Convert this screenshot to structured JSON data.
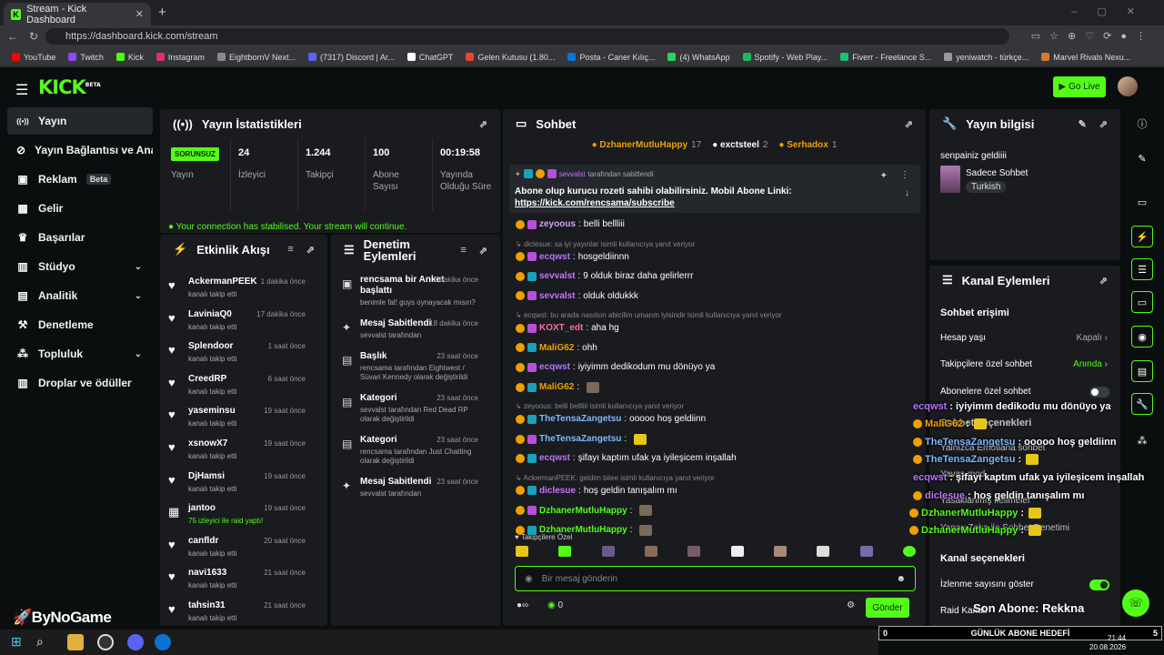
{
  "browser": {
    "tab_title": "Stream - Kick Dashboard",
    "url": "https://dashboard.kick.com/stream",
    "bookmarks": [
      {
        "label": "YouTube",
        "color": "#ff0000"
      },
      {
        "label": "Twitch",
        "color": "#9146ff"
      },
      {
        "label": "Kick",
        "color": "#53fc18"
      },
      {
        "label": "Instagram",
        "color": "#e1306c"
      },
      {
        "label": "EightbornV Next...",
        "color": "#888888"
      },
      {
        "label": "(7317) Discord | Ar...",
        "color": "#5865f2"
      },
      {
        "label": "ChatGPT",
        "color": "#ffffff"
      },
      {
        "label": "Gelen Kutusu (1.80...",
        "color": "#ea4335"
      },
      {
        "label": "Posta - Caner Kılıç...",
        "color": "#0078d4"
      },
      {
        "label": "(4) WhatsApp",
        "color": "#25d366"
      },
      {
        "label": "Spotify - Web Play...",
        "color": "#1db954"
      },
      {
        "label": "Fiverr - Freelance S...",
        "color": "#1dbf73"
      },
      {
        "label": "yeniwatch - türkçe...",
        "color": "#999999"
      },
      {
        "label": "Marvel Rivals Nexu...",
        "color": "#d97b29"
      }
    ]
  },
  "header": {
    "logo": "KICK",
    "logo_tag": "BETA",
    "golive": "Go Live"
  },
  "sidebar": [
    {
      "label": "Yayın",
      "icon": "broadcast-icon"
    },
    {
      "label": "Yayın Bağlantısı ve Anahtar",
      "icon": "link-icon"
    },
    {
      "label": "Reklam",
      "badge": "Beta",
      "icon": "ad-icon"
    },
    {
      "label": "Gelir",
      "icon": "revenue-icon"
    },
    {
      "label": "Başarılar",
      "icon": "trophy-icon"
    },
    {
      "label": "Stüdyo",
      "icon": "studio-icon"
    },
    {
      "label": "Analitik",
      "icon": "analytics-icon"
    },
    {
      "label": "Denetleme",
      "icon": "hammer-icon"
    },
    {
      "label": "Topluluk",
      "icon": "community-icon"
    },
    {
      "label": "Droplar ve ödüller",
      "icon": "gift-icon"
    }
  ],
  "stats": {
    "title": "Yayın İstatistikleri",
    "status": "SORUNSUZ",
    "status_label": "Yayın",
    "viewers": "24",
    "viewers_label": "İzleyici",
    "followers": "1.244",
    "followers_label": "Takipçi",
    "subs": "100",
    "subs_label": "Abone Sayısı",
    "uptime": "00:19:58",
    "uptime_label": "Yayında Olduğu Süre",
    "conn": "Your connection has stabilised. Your stream will continue."
  },
  "feed": {
    "title": "Etkinlik Akışı",
    "items": [
      {
        "name": "AckermanPEEK",
        "sub": "kanalı takip etti",
        "time": "1 dakika önce"
      },
      {
        "name": "LaviniaQ0",
        "sub": "kanalı takip etti",
        "time": "17 dakika önce"
      },
      {
        "name": "Splendoor",
        "sub": "kanalı takip etti",
        "time": "1 saat önce"
      },
      {
        "name": "CreedRP",
        "sub": "kanalı takip etti",
        "time": "6 saat önce"
      },
      {
        "name": "yaseminsu",
        "sub": "kanalı takip etti",
        "time": "19 saat önce"
      },
      {
        "name": "xsnowX7",
        "sub": "kanalı takip etti",
        "time": "19 saat önce"
      },
      {
        "name": "DjHamsi",
        "sub": "kanalı takip etti",
        "time": "19 saat önce"
      },
      {
        "name": "jantoo",
        "sub": "75 izleyici ile raid yaptı!",
        "time": "19 saat önce"
      },
      {
        "name": "canfldr",
        "sub": "kanalı takip etti",
        "time": "20 saat önce"
      },
      {
        "name": "navi1633",
        "sub": "kanalı takip etti",
        "time": "21 saat önce"
      },
      {
        "name": "tahsin31",
        "sub": "kanalı takip etti",
        "time": "21 saat önce"
      }
    ]
  },
  "mod": {
    "title": "Denetim Eylemleri",
    "items": [
      {
        "title": "rencsama bir Anket başlattı",
        "time": "2 dakika önce",
        "sub": "benimle fal! guys oynayacak mısın?"
      },
      {
        "title": "Mesaj Sabitlendi",
        "time": "18 dakika önce",
        "sub": "sevvalst tarafından"
      },
      {
        "title": "Başlık",
        "time": "23 saat önce",
        "sub": "rencsama tarafından Eightwest / Süvari Kennedy olarak değiştirildi"
      },
      {
        "title": "Kategori",
        "time": "23 saat önce",
        "sub": "sevvalst tarafından Red Dead RP olarak değiştirildi"
      },
      {
        "title": "Kategori",
        "time": "23 saat önce",
        "sub": "rencsama tarafından Just Chatting olarak değiştirildi"
      },
      {
        "title": "Mesaj Sabitlendi",
        "time": "23 saat önce",
        "sub": "sevvalst tarafından"
      }
    ]
  },
  "chat": {
    "title": "Sohbet",
    "top": [
      {
        "name": "DzhanerMutluHappy",
        "n": "17",
        "color": "#f0a000"
      },
      {
        "name": "exctsteel",
        "n": "2",
        "color": "#ffffff"
      },
      {
        "name": "Serhadox",
        "n": "1",
        "color": "#f0a000"
      }
    ],
    "pinned_by": "sevvalst",
    "pinned_suffix": "tarafından sabitlendi",
    "pinned_msg": "Abone olup kurucu rozeti sahibi olabilirsiniz. Mobil Abone Linki:",
    "pinned_link": "https://kick.com/rencsama/subscribe",
    "messages": [
      {
        "user": "zeyoous",
        "color": "#d4a0ff",
        "text": "belli bellliii"
      },
      {
        "reply": "diclesue: sa iyi yayınlar isimli kullanıcıya yanıt veriyor"
      },
      {
        "user": "ecqwst",
        "color": "#b873ff",
        "text": "hosgeldiinnn"
      },
      {
        "user": "sevvalst",
        "color": "#c873ff",
        "text": "9 olduk biraz daha gelirlerrr"
      },
      {
        "user": "sevvalst",
        "color": "#c873ff",
        "text": "olduk oldukkk"
      },
      {
        "reply": "ecqwst: bu arada nasılsın abicilim umarım iyisindir isimli kullanıcıya yanıt veriyor"
      },
      {
        "user": "KOXT_edt",
        "color": "#ff6b9a",
        "text": "aha hg"
      },
      {
        "user": "MaliG62",
        "color": "#f0a000",
        "text": "ohh"
      },
      {
        "user": "ecqwst",
        "color": "#b873ff",
        "text": "iyiyimm dedikodum mu dönüyo ya"
      },
      {
        "user": "MaliG62",
        "color": "#f0a000",
        "text": ""
      },
      {
        "reply": "zeyoous: belli bellliii isimli kullanıcıya yanıt veriyor"
      },
      {
        "user": "TheTensaZangetsu",
        "color": "#7fb8ff",
        "text": "ooooo hoş geldiinn"
      },
      {
        "user": "TheTensaZangetsu",
        "color": "#7fb8ff",
        "text": ""
      },
      {
        "user": "ecqwst",
        "color": "#b873ff",
        "text": "şifayı kaptım ufak ya iyileşicem inşallah"
      },
      {
        "reply": "AckermanPEEK: geldim bilee isimli kullanıcıya yanıt veriyor"
      },
      {
        "user": "diclesue",
        "color": "#c873ff",
        "text": "hoş geldin tanışalım mı"
      },
      {
        "user": "DzhanerMutluHappy",
        "color": "#53fc18",
        "text": ""
      },
      {
        "user": "DzhanerMutluHappy",
        "color": "#53fc18",
        "text": ""
      }
    ],
    "follow_only": "Takipçilere Özel",
    "placeholder": "Bir mesaj gönderin",
    "points": "0",
    "send": "Gönder"
  },
  "info": {
    "title": "Yayın bilgisi",
    "stream_title": "senpainiz geldiiii",
    "category": "Sadece Sohbet",
    "tag": "Turkish"
  },
  "channel": {
    "title": "Kanal Eylemleri",
    "section1": "Sohbet erişimi",
    "rows": [
      {
        "label": "Hesap yaşı",
        "value": "Kapalı"
      },
      {
        "label": "Takipçilere özel sohbet",
        "value": "Anında"
      },
      {
        "label": "Abonelere özel sohbet",
        "value": ""
      }
    ],
    "section2": "Kanal seçenekleri",
    "viewcount": "İzlenme sayısını göster",
    "raid": "Raid Kanalı"
  },
  "overlay": {
    "msgs": [
      {
        "user": "ecqwst",
        "color": "#b873ff",
        "text": ": iyiyimm dedikodu mu dönüyo ya"
      },
      {
        "user": "MaliG62",
        "color": "#f0a000",
        "text": ":"
      },
      {
        "user": "TheTensaZangetsu",
        "color": "#7fb8ff",
        "text": ": ooooo hoş geldiinn"
      },
      {
        "user": "TheTensaZangetsu",
        "color": "#7fb8ff",
        "text": ":"
      },
      {
        "user": "ecqwst",
        "color": "#b873ff",
        "text": ": şifayı kaptım ufak ya iyileşicem inşallah"
      },
      {
        "user": "diclesue",
        "color": "#c873ff",
        "text": ": hoş geldin tanışalım mı"
      },
      {
        "user": "DzhanerMutluHappy",
        "color": "#53fc18",
        "text": ":"
      },
      {
        "user": "DzhanerMutluHappy",
        "color": "#53fc18",
        "text": ":"
      }
    ],
    "behind": [
      "Sohbet seçenekleri",
      "Yalnızca Emotlarla sohbet",
      "Yavaş mod",
      "Yasaklanmış kelimeler",
      "Yapay Zeka ile Sohbet Denetimi"
    ],
    "son_abone": "Son Abone: Rekkna",
    "goal_left": "0",
    "goal_title": "GÜNLÜK ABONE HEDEFİ",
    "goal_right": "5",
    "watermark": "ByNoGame"
  },
  "system": {
    "time": "21:44",
    "date": "20.08.2026"
  }
}
